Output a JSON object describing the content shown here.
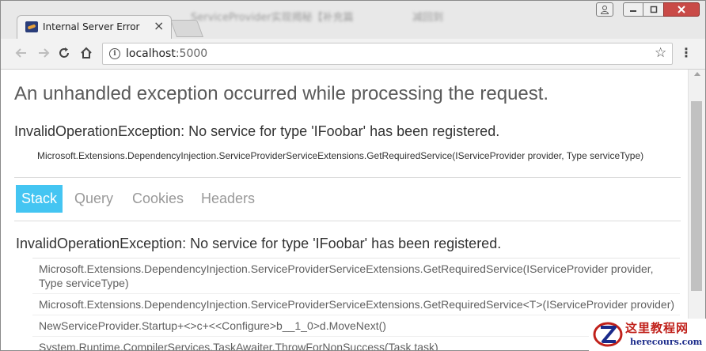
{
  "browser": {
    "tab_title": "Internal Server Error",
    "tab_close": "×",
    "background_text_left": "ServiceProvider实现揭秘【补充篇",
    "background_text_right": "减回到",
    "url_host": "localhost",
    "url_port": ":5000",
    "icons": {
      "back": "back-arrow-icon",
      "forward": "forward-arrow-icon",
      "reload": "reload-icon",
      "home": "home-icon",
      "info": "info-icon",
      "star": "star-icon",
      "menu": "menu-icon"
    },
    "window_controls": {
      "user": "user-icon",
      "minimize": "minimize-icon",
      "maximize": "maximize-icon",
      "close": "close-icon"
    }
  },
  "page": {
    "title": "An unhandled exception occurred while processing the request.",
    "exception_message": "InvalidOperationException: No service for type 'IFoobar' has been registered.",
    "exception_location": "Microsoft.Extensions.DependencyInjection.ServiceProviderServiceExtensions.GetRequiredService(IServiceProvider provider, Type serviceType)",
    "tabs": [
      {
        "label": "Stack",
        "active": true
      },
      {
        "label": "Query",
        "active": false
      },
      {
        "label": "Cookies",
        "active": false
      },
      {
        "label": "Headers",
        "active": false
      }
    ],
    "stack": {
      "title": "InvalidOperationException: No service for type 'IFoobar' has been registered.",
      "frames": [
        "Microsoft.Extensions.DependencyInjection.ServiceProviderServiceExtensions.GetRequiredService(IServiceProvider provider, Type serviceType)",
        "Microsoft.Extensions.DependencyInjection.ServiceProviderServiceExtensions.GetRequiredService<T>(IServiceProvider provider)",
        "NewServiceProvider.Startup+<>c+<<Configure>b__1_0>d.MoveNext()",
        "System.Runtime.CompilerServices.TaskAwaiter.ThrowForNonSuccess(Task task)"
      ]
    }
  },
  "watermark": {
    "cn": "这里教程网",
    "en": "herecours.com"
  },
  "colors": {
    "active_tab": "#44c5f2",
    "title_text": "#5a5a5a",
    "close_button": "#c94a47"
  }
}
